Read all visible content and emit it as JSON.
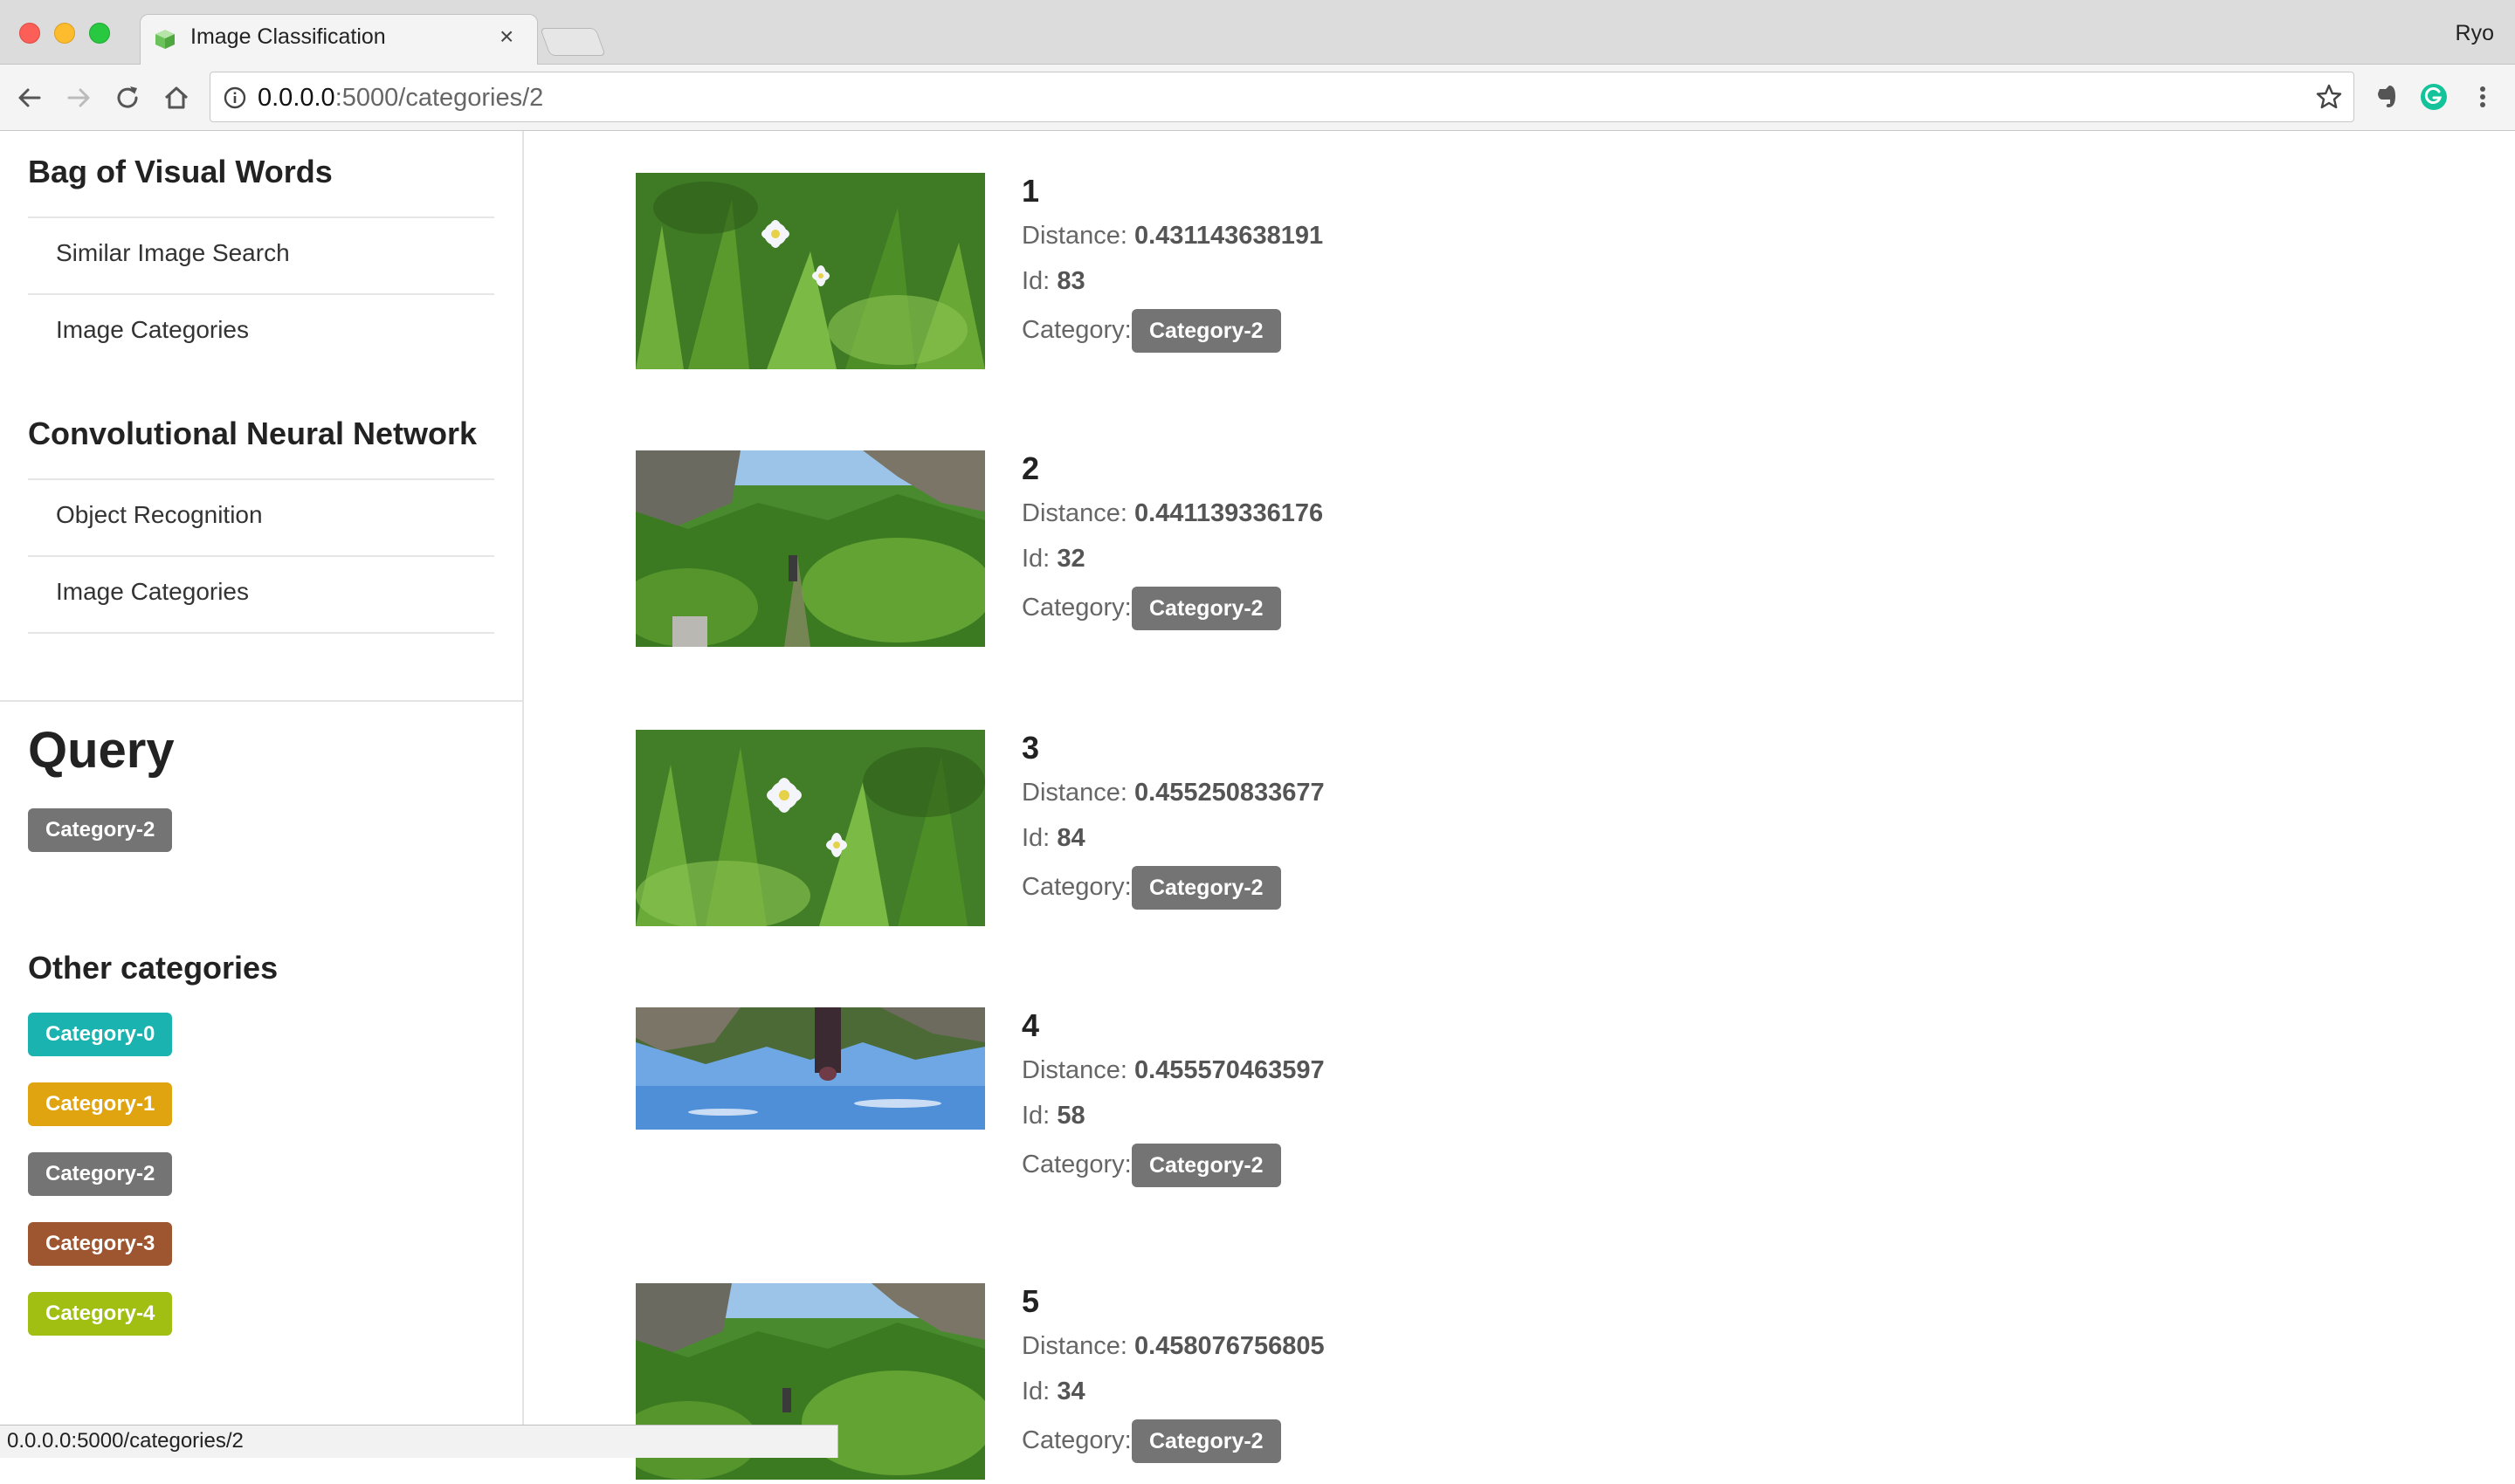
{
  "browser": {
    "tab_title": "Image Classification",
    "tab_close": "×",
    "profile_name": "Ryo",
    "url_host": "0.0.0.0",
    "url_path": ":5000/categories/2",
    "status_url": "0.0.0.0:5000/categories/2"
  },
  "sidebar": {
    "sections": [
      {
        "title": "Bag of Visual Words",
        "items": [
          "Similar Image Search",
          "Image Categories"
        ]
      },
      {
        "title": "Convolutional Neural Network",
        "items": [
          "Object Recognition",
          "Image Categories"
        ]
      }
    ],
    "query_title": "Query",
    "query_badge": {
      "label": "Category-2",
      "color": "#747474"
    },
    "other_title": "Other categories",
    "other_categories": [
      {
        "label": "Category-0",
        "color": "#1ab3b0"
      },
      {
        "label": "Category-1",
        "color": "#e0a410"
      },
      {
        "label": "Category-2",
        "color": "#747474"
      },
      {
        "label": "Category-3",
        "color": "#9e5630"
      },
      {
        "label": "Category-4",
        "color": "#a0bf12"
      }
    ]
  },
  "labels": {
    "distance": "Distance:",
    "id": "Id:",
    "category": "Category:"
  },
  "results": [
    {
      "rank": "1",
      "distance": "0.431143638191",
      "id": "83",
      "category": "Category-2",
      "image": "flower"
    },
    {
      "rank": "2",
      "distance": "0.441139336176",
      "id": "32",
      "category": "Category-2",
      "image": "trail"
    },
    {
      "rank": "3",
      "distance": "0.455250833677",
      "id": "84",
      "category": "Category-2",
      "image": "flower"
    },
    {
      "rank": "4",
      "distance": "0.455570463597",
      "id": "58",
      "category": "Category-2",
      "image": "upside-down-sky"
    },
    {
      "rank": "5",
      "distance": "0.458076756805",
      "id": "34",
      "category": "Category-2",
      "image": "trail"
    }
  ]
}
